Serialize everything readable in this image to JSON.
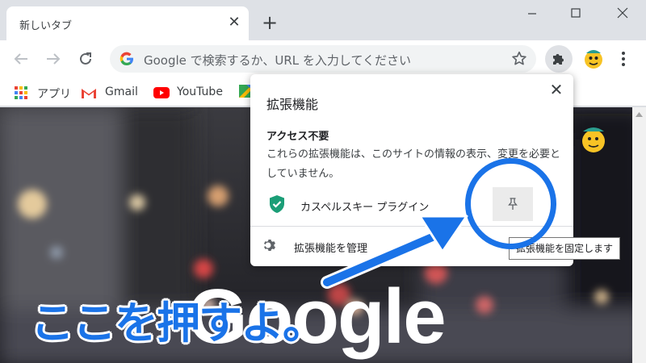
{
  "tab": {
    "title": "新しいタブ",
    "close_glyph": "✕"
  },
  "new_tab_glyph": "+",
  "omnibox": {
    "placeholder": "Google で検索するか、URL を入力してください"
  },
  "bookmarks": [
    {
      "label": "アプリ",
      "icon": "apps-grid-icon"
    },
    {
      "label": "Gmail",
      "icon": "gmail-icon"
    },
    {
      "label": "YouTube",
      "icon": "youtube-icon"
    }
  ],
  "extensions_popup": {
    "title": "拡張機能",
    "close_glyph": "✕",
    "section_title": "アクセス不要",
    "section_description": "これらの拡張機能は、このサイトの情報の表示、変更を必要としていません。",
    "extension": {
      "name": "カスペルスキー プラグイン",
      "icon": "shield-check-icon"
    },
    "manage_label": "拡張機能を管理"
  },
  "tooltip": "拡張機能を固定します",
  "background": {
    "logo_text": "Google"
  },
  "annotation": {
    "caption": "ここを押すよ。"
  },
  "colors": {
    "accent_blue": "#1a73e8",
    "tabstrip": "#dee1e6",
    "shield_green": "#1b9e77",
    "gmail_red": "#ea4335",
    "youtube_red": "#ff0000"
  }
}
